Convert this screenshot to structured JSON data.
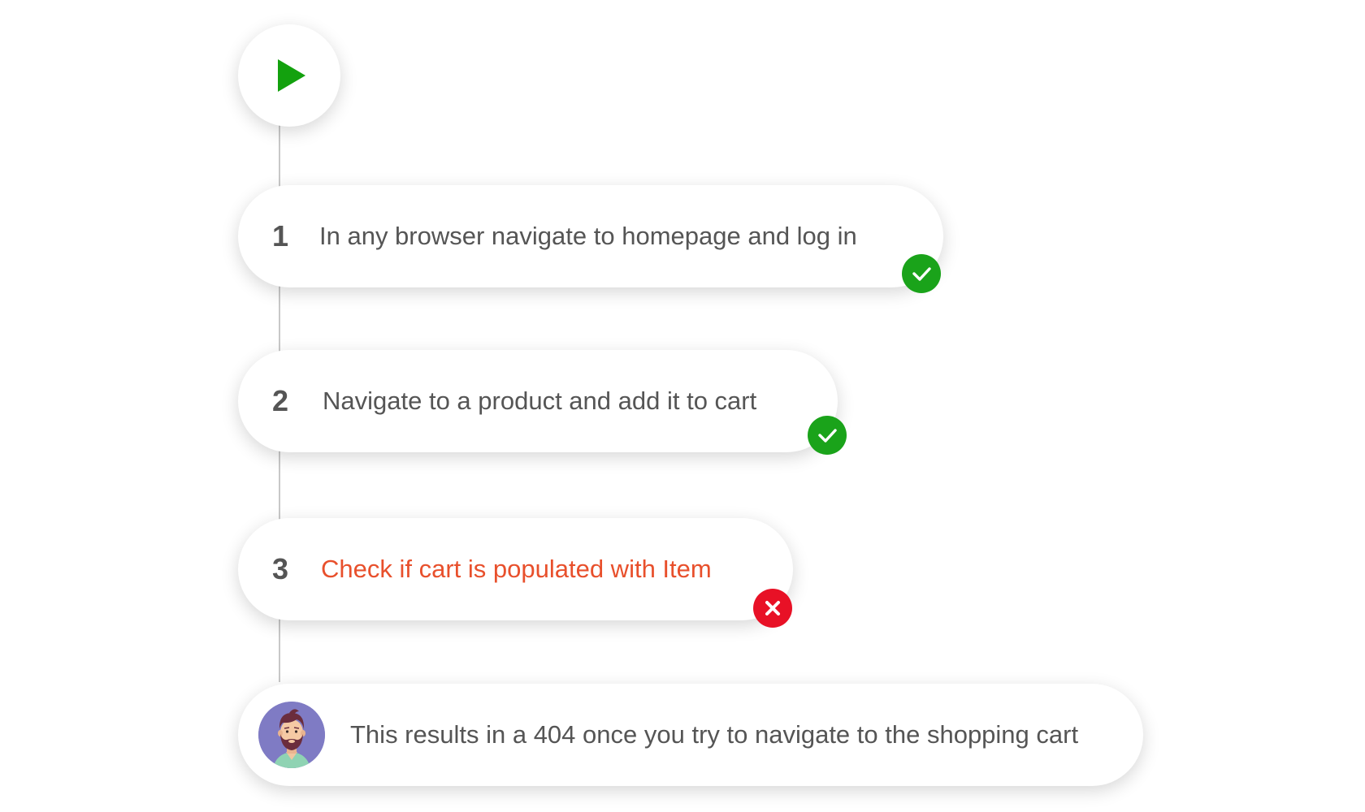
{
  "timeline": {
    "start_icon": "play-icon",
    "steps": [
      {
        "number": "1",
        "text": "In any browser navigate to homepage and log in",
        "status": "pass",
        "status_icon": "check-icon"
      },
      {
        "number": "2",
        "text": "Navigate to a product and add it to cart",
        "status": "pass",
        "status_icon": "check-icon"
      },
      {
        "number": "3",
        "text": "Check if cart is populated with Item",
        "status": "fail",
        "status_icon": "x-icon"
      }
    ],
    "comment": {
      "avatar_icon": "bearded-man-avatar",
      "text": "This results in a 404 once you try to navigate to the shopping cart"
    }
  },
  "colors": {
    "pass": "#1aa31a",
    "fail": "#e81126",
    "fail_text": "#e8502c",
    "play": "#13a10e"
  }
}
